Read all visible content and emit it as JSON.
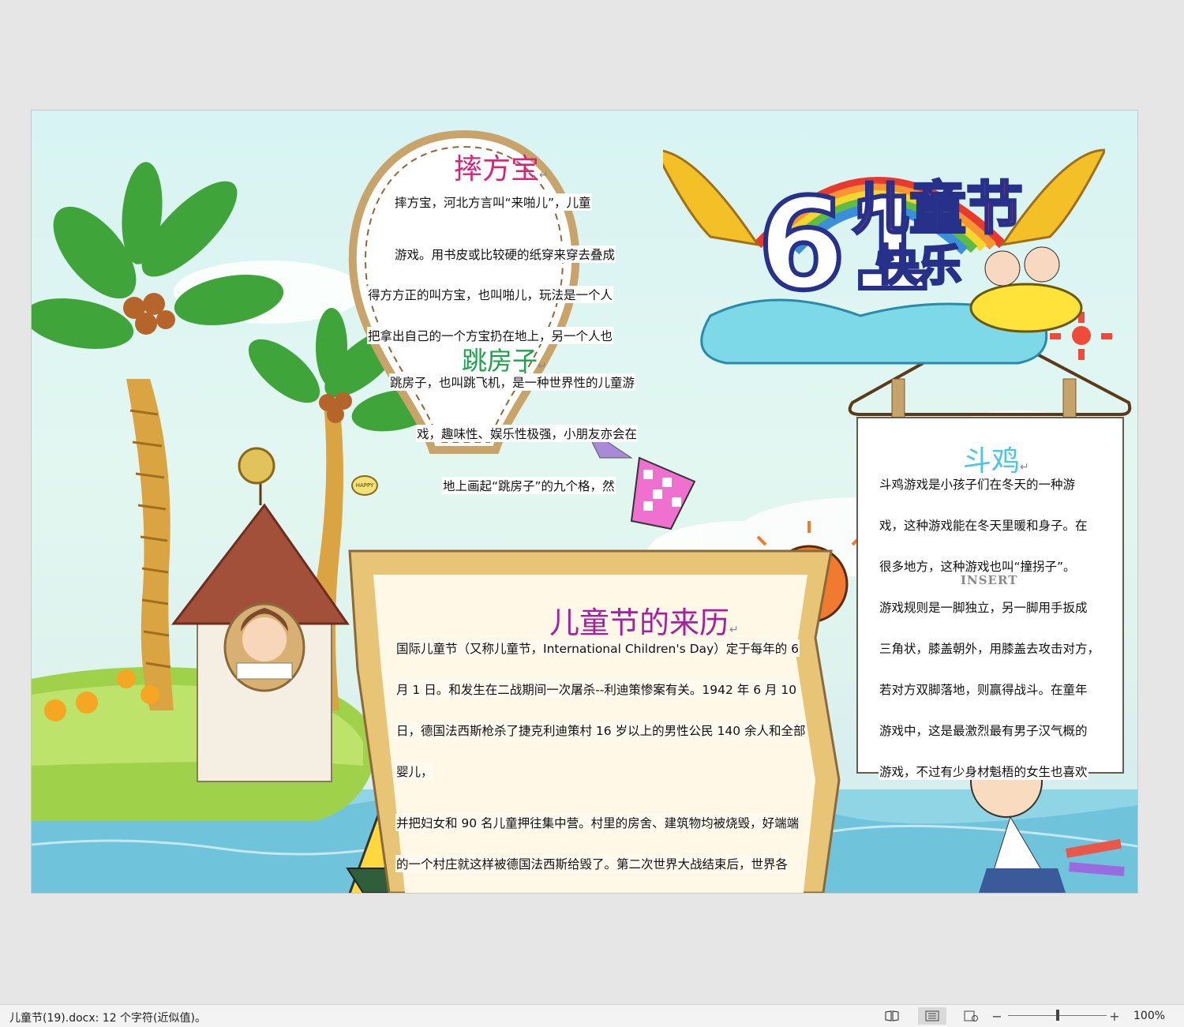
{
  "document": {
    "logo_text": {
      "line1": "儿童节",
      "line2": "快乐",
      "number": "61"
    },
    "sections": {
      "pengfangbao": {
        "title": "摔方宝",
        "lines": [
          "摔方宝，河北方言叫“来啪儿”，儿童",
          "游戏。用书皮或比较硬的纸穿来穿去叠成",
          "得方方正的叫方宝，也叫啪儿，玩法是一个人",
          "把拿出自己的一个方宝扔在地上，另一个人也"
        ]
      },
      "tiaofangzi": {
        "title": "跳房子",
        "lines": [
          "跳房子，也叫跳飞机，是一种世界性的儿童游",
          "戏，趣味性、娱乐性极强，小朋友亦会在",
          "地上画起“跳房子”的九个格，然"
        ]
      },
      "douji": {
        "title": "斗鸡",
        "lines": [
          "斗鸡游戏是小孩子们在冬天的一种游",
          "戏，这种游戏能在冬天里暖和身子。在",
          "很多地方，这种游戏也叫“撞拐子”。",
          "游戏规则是一脚独立，另一脚用手扳成",
          "三角状，膝盖朝外，用膝盖去攻击对方，",
          "若对方双脚落地，则赢得战斗。在童年",
          "游戏中，这是最激烈最有男子汉气概的",
          "游戏，不过有少身材魁梧的女生也喜欢"
        ],
        "insert_label": "INSERT"
      },
      "laili": {
        "title": "儿童节的来历",
        "lines": [
          "国际儿童节（又称儿童节，International Children's Day）定于每年的 6",
          "月 1 日。和发生在二战期间一次屠杀--利迪策惨案有关。1942 年 6 月 10",
          "日，德国法西斯枪杀了捷克利迪策村 16 岁以上的男性公民 140 余人和全部",
          "婴儿，",
          "并把妇女和 90 名儿童押往集中营。村里的房舍、建筑物均被烧毁，好端端",
          "的一个村庄就这样被德国法西斯给毁了。第二次世界大战结束后，世界各"
        ]
      }
    },
    "signs": {
      "happy": "HAPPY"
    }
  },
  "statusbar": {
    "doc_info": "儿童节(19).docx: 12 个字符(近似值)。",
    "zoom_minus": "−",
    "zoom_plus": "+",
    "zoom": "100%",
    "zoom_level_fraction": 0.5
  },
  "colors": {
    "accent_pink": "#d6247a",
    "accent_green": "#1aa34a",
    "accent_cyan": "#4cc6e6",
    "accent_purple": "#a4229f"
  }
}
